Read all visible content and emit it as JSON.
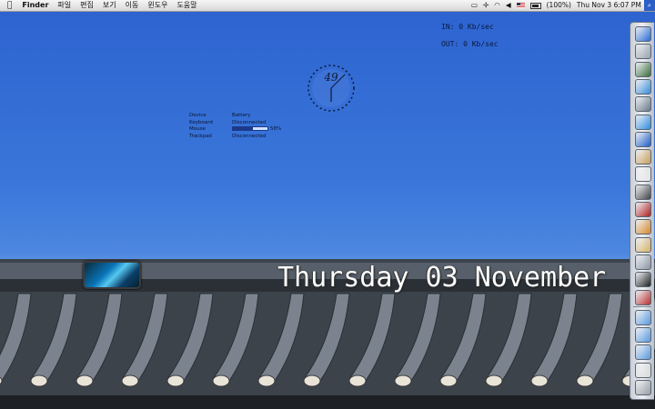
{
  "menubar": {
    "apple": "",
    "app": "Finder",
    "menus": [
      "파일",
      "편집",
      "보기",
      "이동",
      "윈도우",
      "도움말"
    ],
    "battery": "(100%)",
    "clock": "Thu Nov 3  6:07 PM"
  },
  "network": {
    "in": "IN: 0 Kb/sec",
    "out": "OUT: 0 Kb/sec"
  },
  "clock_widget": {
    "value": "49"
  },
  "bluetooth": {
    "headers": [
      "Device",
      "Battery"
    ],
    "rows": [
      {
        "device": "Keyboard",
        "status": "Disconnected"
      },
      {
        "device": "Mouse",
        "status": "58%",
        "level": 0.58
      },
      {
        "device": "Trackpad",
        "status": "Disconnected"
      }
    ]
  },
  "date_text": "Thursday 03 November",
  "dock": {
    "icons": [
      "finder-icon",
      "rocket-icon",
      "dashboard-icon",
      "safari-icon",
      "mail-icon",
      "appstore-icon",
      "itunes-icon",
      "preview-icon",
      "calendar-icon",
      "facetime-icon",
      "photobooth-icon",
      "garageband-icon",
      "iphoto-icon",
      "system-prefs-icon",
      "terminal-icon",
      "app-icon",
      "folder-icon",
      "folder-icon",
      "downloads-icon",
      "drive-icon",
      "trash-icon"
    ]
  },
  "colors": {
    "sky": "#2f6ad1",
    "menubar": "#e8e8e8",
    "date_text": "#ffffff"
  }
}
